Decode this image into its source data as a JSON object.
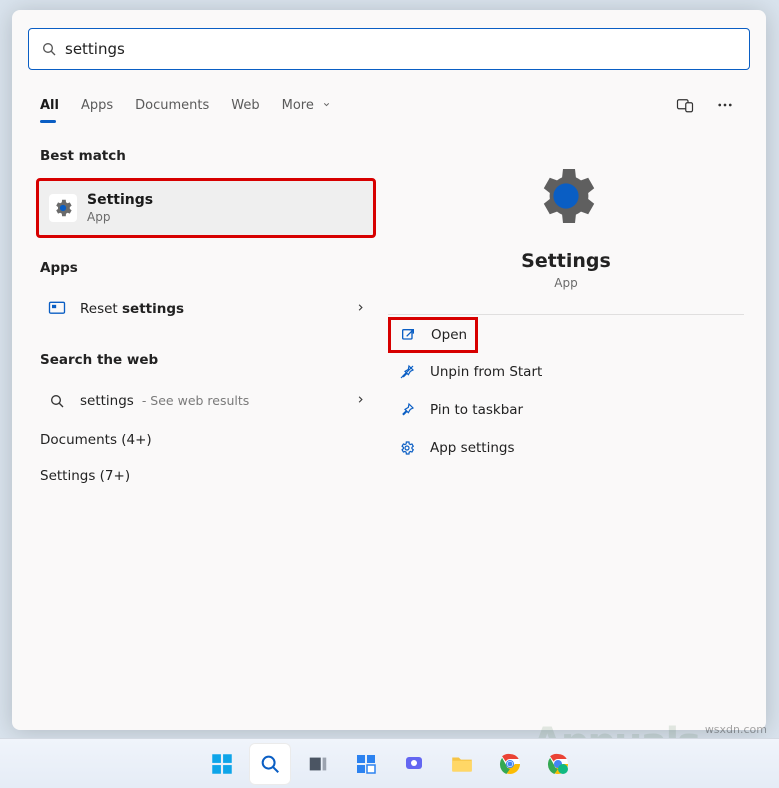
{
  "search": {
    "value": "settings"
  },
  "tabs": {
    "all": "All",
    "apps": "Apps",
    "documents": "Documents",
    "web": "Web",
    "more": "More"
  },
  "sections": {
    "best_match": "Best match",
    "apps": "Apps",
    "search_web": "Search the web",
    "documents": "Documents (4+)",
    "settings": "Settings (7+)"
  },
  "best_match_item": {
    "title": "Settings",
    "subtitle": "App"
  },
  "apps_section": {
    "reset_prefix": "Reset ",
    "reset_bold": "settings"
  },
  "web_section": {
    "term": "settings",
    "hint": " - See web results"
  },
  "detail": {
    "title": "Settings",
    "subtitle": "App",
    "actions": {
      "open": "Open",
      "unpin": "Unpin from Start",
      "pin_taskbar": "Pin to taskbar",
      "app_settings": "App settings"
    }
  },
  "watermark": "wsxdn.com"
}
